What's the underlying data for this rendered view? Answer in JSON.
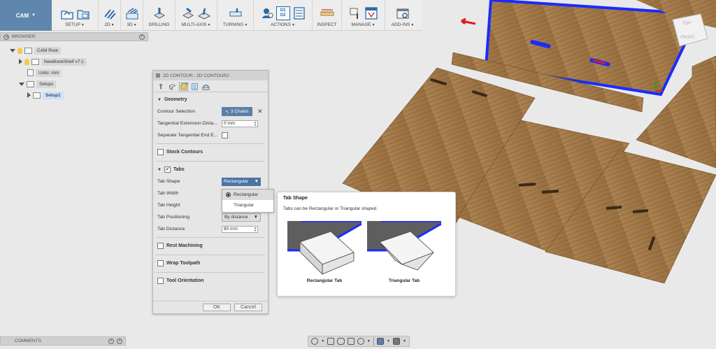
{
  "toolbar": {
    "cam": "CAM",
    "groups": [
      {
        "label": "SETUP",
        "caret": true
      },
      {
        "label": "2D",
        "caret": true
      },
      {
        "label": "3D",
        "caret": true
      },
      {
        "label": "DRILLING",
        "caret": false
      },
      {
        "label": "MULTI-AXIS",
        "caret": true
      },
      {
        "label": "TURNING",
        "caret": true
      },
      {
        "label": "ACTIONS",
        "caret": true
      },
      {
        "label": "INSPECT",
        "caret": false
      },
      {
        "label": "MANAGE",
        "caret": true
      },
      {
        "label": "ADD-INS",
        "caret": true
      }
    ],
    "g1": "G1",
    "g2": "G2"
  },
  "browser": {
    "title": "BROWSER",
    "cam_root": "CAM Root",
    "model": "NewBookShelf v7:1",
    "units": "Units: mm",
    "setups": "Setups",
    "setup1": "Setup1"
  },
  "comments": {
    "title": "COMMENTS"
  },
  "dialog": {
    "title": "2D CONTOUR : 2D CONTOUR2",
    "geometry": {
      "heading": "Geometry",
      "contour_selection_label": "Contour Selection",
      "chains": "3 Chains",
      "tangential_ext_label": "Tangential Extension Dista...",
      "tangential_ext_value": "0 mm",
      "separate_tangential_label": "Separate Tangential End E..."
    },
    "stock_contours": "Stock Contours",
    "tabs": {
      "heading": "Tabs",
      "shape_label": "Tab Shape",
      "shape_value": "Rectangular",
      "width_label": "Tab Width",
      "height_label": "Tab Height",
      "positioning_label": "Tab Positioning",
      "positioning_value": "By distance",
      "distance_label": "Tab Distance",
      "distance_value": "80 mm"
    },
    "rest_machining": "Rest Machining",
    "wrap_toolpath": "Wrap Toolpath",
    "tool_orientation": "Tool Orientation",
    "ok": "OK",
    "cancel": "Cancel"
  },
  "dropdown": {
    "options": [
      "Rectangular",
      "Triangular"
    ],
    "selected": "Rectangular"
  },
  "tooltip": {
    "title": "Tab Shape",
    "description": "Tabs can be Rectangular or Triangular shaped.",
    "caption_left": "Rectangular Tab",
    "caption_right": "Triangular Tab"
  },
  "viewcube": {
    "top": "TOP",
    "front": "FRONT"
  },
  "colors": {
    "cam_blue": "#5f87ad",
    "wood": "#a47a4a",
    "select_blue": "#1a2cff"
  }
}
